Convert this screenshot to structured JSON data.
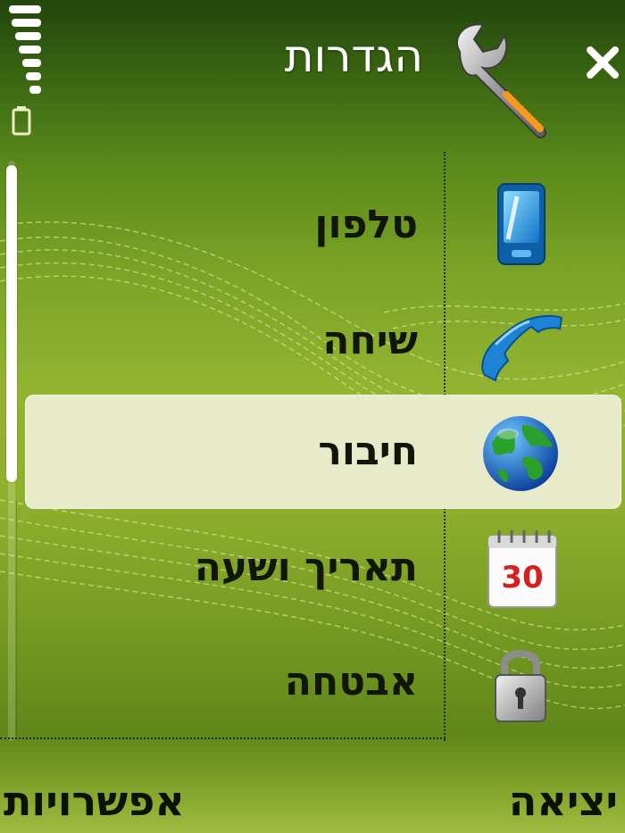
{
  "header": {
    "title": "הגדרות",
    "app_icon": "wrench-icon",
    "close_icon": "close-icon"
  },
  "status": {
    "signal_icon": "signal-strength-icon",
    "battery_icon": "battery-icon"
  },
  "menu": {
    "items": [
      {
        "label": "טלפון",
        "icon": "phone-device-icon",
        "selected": false
      },
      {
        "label": "שיחה",
        "icon": "call-handset-icon",
        "selected": false
      },
      {
        "label": "חיבור",
        "icon": "globe-icon",
        "selected": true
      },
      {
        "label": "תאריך ושעה",
        "icon": "calendar-icon",
        "selected": false,
        "icon_text": "30"
      },
      {
        "label": "אבטחה",
        "icon": "lock-icon",
        "selected": false
      }
    ]
  },
  "softkeys": {
    "left": "אפשרויות",
    "right": "יציאה"
  },
  "colors": {
    "background_green": "#7ca426",
    "selection": "#e8ebc9",
    "text": "#121608"
  }
}
